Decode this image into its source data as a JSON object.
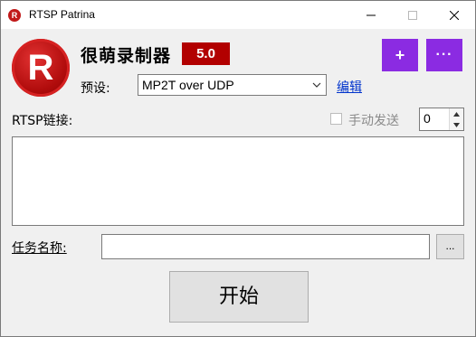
{
  "window": {
    "title": "RTSP Patrina"
  },
  "header": {
    "logo_letter": "R",
    "app_name": "很萌录制器",
    "version": "5.0",
    "add_label": "+",
    "more_label": "···"
  },
  "preset": {
    "label": "预设:",
    "selected": "MP2T over UDP",
    "edit_label": "编辑"
  },
  "rtsp": {
    "label": "RTSP链接:",
    "value": "",
    "manual_send_label": "手动发送",
    "manual_send_checked": false,
    "counter_value": "0"
  },
  "task": {
    "label": "任务名称:",
    "value": "",
    "browse_label": "..."
  },
  "actions": {
    "start_label": "开始"
  },
  "colors": {
    "accent_purple": "#8b2be2",
    "brand_red": "#b20000",
    "link_blue": "#0033cc"
  }
}
